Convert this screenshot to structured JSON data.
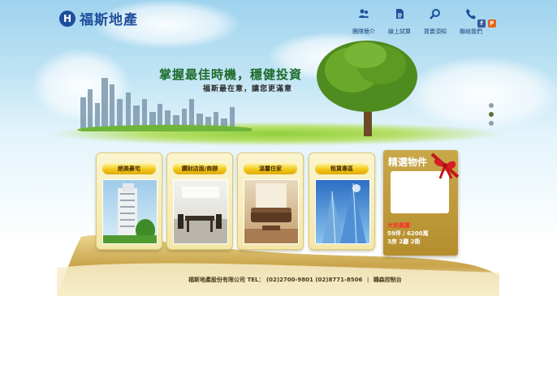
{
  "brand": {
    "mark": "H",
    "name": "福斯地產"
  },
  "nav": [
    {
      "label": "團隊簡介",
      "icon": "team-icon"
    },
    {
      "label": "線上試算",
      "icon": "document-icon"
    },
    {
      "label": "買賣須知",
      "icon": "search-icon"
    },
    {
      "label": "聯絡我們",
      "icon": "phone-icon"
    }
  ],
  "social": {
    "facebook": "f",
    "plurk": "P"
  },
  "hero": {
    "slogan": "掌握最佳時機，穩健投資",
    "subslogan": "福斯最在意，讓您更滿意"
  },
  "categories": [
    {
      "label": "絕美豪宅"
    },
    {
      "label": "鑽財店面/商辦"
    },
    {
      "label": "溫馨住家"
    },
    {
      "label": "租賃專區"
    }
  ],
  "featured": {
    "title": "精選物件",
    "name": "大安美廈",
    "size_price": "59坪 / 6200萬",
    "layout": "3房 2廳 2衛"
  },
  "footer": {
    "company": "福斯地產股份有限公司",
    "tel_label": "TEL：",
    "phones": "(02)2700-9801  (02)8771-8506",
    "credit": "職森控制台"
  },
  "colors": {
    "brand": "#1e4f9c",
    "slogan": "#1d6b2a",
    "gold": "#c9a84a",
    "tab": "#f2c918",
    "featured_name": "#ff2a2a"
  }
}
